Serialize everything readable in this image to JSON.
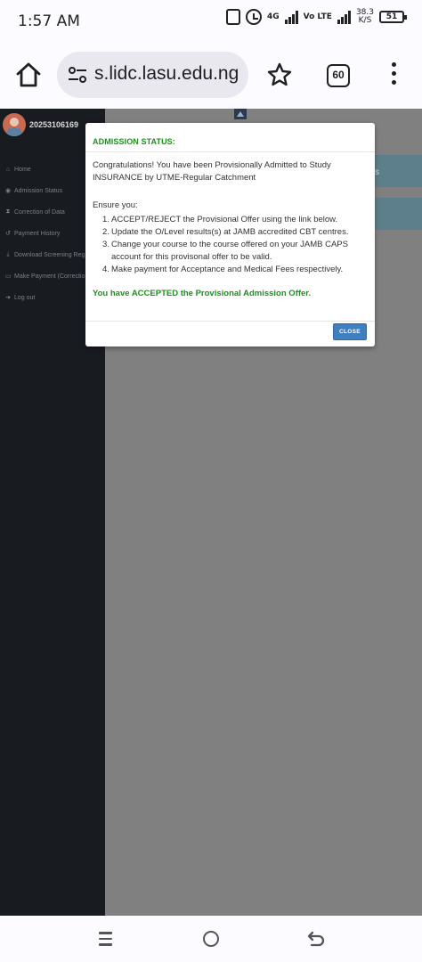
{
  "status_bar": {
    "time": "1:57 AM",
    "network_top": "4G",
    "network_bottom": "Vo LTE",
    "speed_value": "38.3",
    "speed_unit": "K/S",
    "battery": "51"
  },
  "browser": {
    "url": "s.lidc.lasu.edu.ng",
    "tab_count": "60"
  },
  "sidebar": {
    "user_id": "20253106169",
    "user_status": "",
    "items": [
      {
        "label": "Home",
        "icon": "home-icon"
      },
      {
        "label": "Admission Status",
        "icon": "eye-icon"
      },
      {
        "label": "Correction of Data",
        "icon": "hourglass-icon"
      },
      {
        "label": "Payment History",
        "icon": "history-icon"
      },
      {
        "label": "Download Screening Reg",
        "icon": "download-icon"
      },
      {
        "label": "Make Payment (Correctio",
        "icon": "credit-card-icon"
      },
      {
        "label": "Log out",
        "icon": "logout-icon"
      }
    ]
  },
  "background": {
    "panel_text": "s"
  },
  "modal": {
    "title": "ADMISSION STATUS:",
    "congrats": "Congratulations! You have been Provisionally Admitted to Study INSURANCE by UTME-Regular Catchment",
    "ensure_heading": "Ensure you:",
    "steps": [
      {
        "num": "1.",
        "text": "ACCEPT/REJECT the Provisional Offer using the link below."
      },
      {
        "num": "2.",
        "text": "Update the O/Level results(s) at JAMB accredited CBT centres."
      },
      {
        "num": "3.",
        "text": "Change your course to the course offered on your JAMB CAPS account for this provisonal offer to be valid."
      },
      {
        "num": "4.",
        "text": "Make payment for Acceptance and Medical Fees respectively."
      }
    ],
    "accepted_message": "You have ACCEPTED the Provisional Admission Offer.",
    "close_label": "CLOSE"
  },
  "colors": {
    "success_green": "#1f8f1f",
    "close_button_blue": "#3f7fbf",
    "sidebar_bg": "#181b20",
    "overlay_gray": "#808080"
  }
}
